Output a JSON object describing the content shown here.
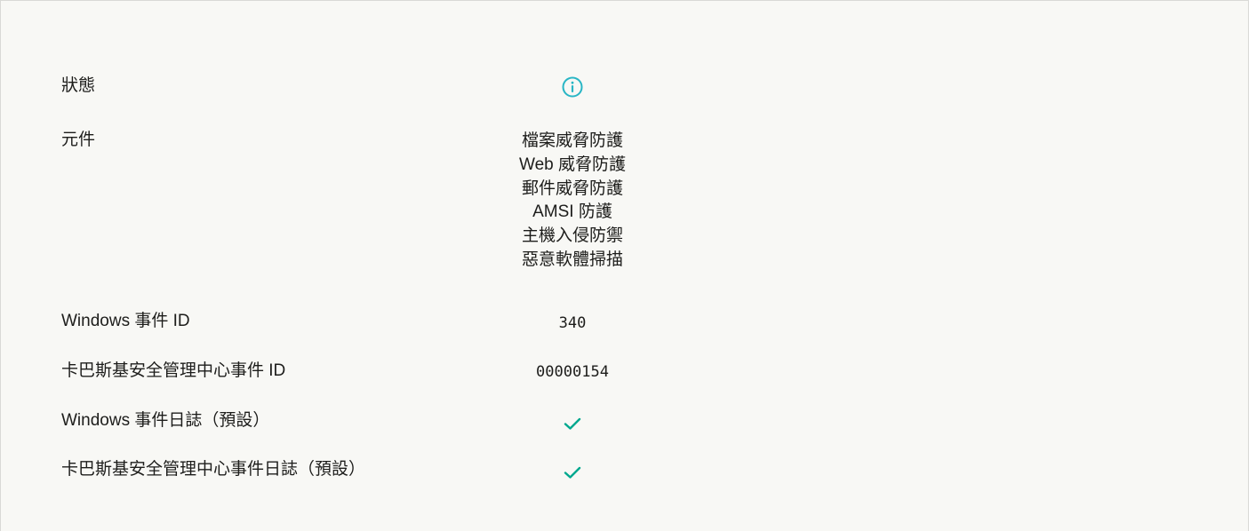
{
  "rows": {
    "status": {
      "label": "狀態",
      "icon": "info-icon",
      "icon_color": "#29b6c5"
    },
    "components": {
      "label": "元件",
      "items": [
        "檔案威脅防護",
        "Web 威脅防護",
        "郵件威脅防護",
        "AMSI 防護",
        "主機入侵防禦",
        "惡意軟體掃描"
      ]
    },
    "windows_event_id": {
      "label": "Windows 事件 ID",
      "value": "340"
    },
    "ksc_event_id": {
      "label": "卡巴斯基安全管理中心事件 ID",
      "value": "00000154"
    },
    "windows_event_log": {
      "label": "Windows 事件日誌（預設）",
      "icon": "checkmark-icon",
      "icon_color": "#00a88e"
    },
    "ksc_event_log": {
      "label": "卡巴斯基安全管理中心事件日誌（預設）",
      "icon": "checkmark-icon",
      "icon_color": "#00a88e"
    }
  }
}
